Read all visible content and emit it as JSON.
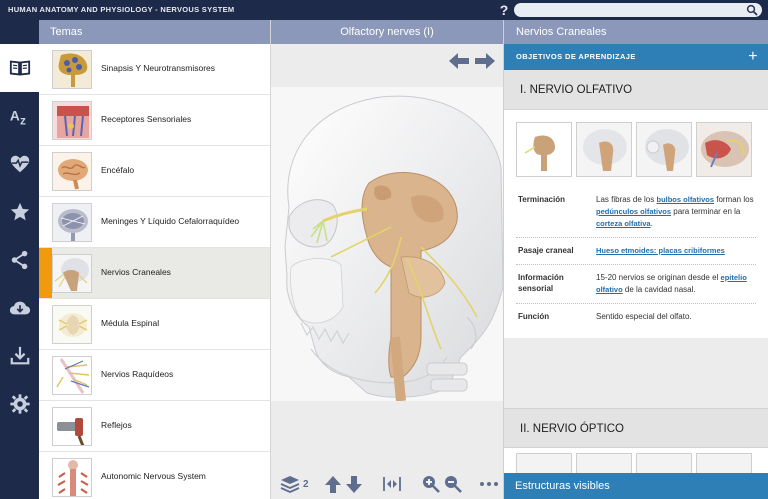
{
  "app": {
    "title": "HUMAN ANATOMY AND PHYSIOLOGY - NERVOUS SYSTEM",
    "help_icon": "help-icon",
    "search_placeholder": ""
  },
  "rail": {
    "items": [
      {
        "icon": "book-icon",
        "active": true
      },
      {
        "icon": "a-z-icon",
        "active": false
      },
      {
        "icon": "heartbeat-icon",
        "active": false
      },
      {
        "icon": "star-icon",
        "active": false
      },
      {
        "icon": "share-icon",
        "active": false
      },
      {
        "icon": "cloud-download-icon",
        "active": false
      },
      {
        "icon": "download-icon",
        "active": false
      },
      {
        "icon": "gear-icon",
        "active": false
      }
    ]
  },
  "topics": {
    "header": "Temas",
    "items": [
      {
        "label": "Sinapsis Y Neurotransmisores"
      },
      {
        "label": "Receptores Sensoriales"
      },
      {
        "label": "Encéfalo"
      },
      {
        "label": "Meninges Y Líquido Cefalorraquídeo"
      },
      {
        "label": "Nervios Craneales",
        "selected": true
      },
      {
        "label": "Médula Espinal"
      },
      {
        "label": "Nervios Raquídeos"
      },
      {
        "label": "Reflejos"
      },
      {
        "label": "Autonomic Nervous System"
      }
    ]
  },
  "viewer": {
    "header": "Olfactory nerves (I)",
    "layer_count": "2"
  },
  "info": {
    "header": "Nervios Craneales",
    "objectives": "OBJETIVOS DE APRENDIZAJE",
    "section1": {
      "title": "I. NERVIO OLFATIVO",
      "rows": [
        {
          "key": "Terminación",
          "parts": [
            {
              "t": "Las fibras de los "
            },
            {
              "t": "bulbos olfativos",
              "link": true
            },
            {
              "t": " forman los "
            },
            {
              "t": "pedúnculos olfativos",
              "link": true
            },
            {
              "t": " para terminar en la "
            },
            {
              "t": "corteza olfativa",
              "link": true
            },
            {
              "t": "."
            }
          ]
        },
        {
          "key": "Pasaje craneal",
          "parts": [
            {
              "t": "Hueso etmoides: placas cribiformes",
              "link": true
            }
          ]
        },
        {
          "key": "Información sensorial",
          "parts": [
            {
              "t": "15-20 nervios se originan desde el "
            },
            {
              "t": "epitelio olfativo",
              "link": true
            },
            {
              "t": " de la cavidad nasal."
            }
          ]
        },
        {
          "key": "Función",
          "parts": [
            {
              "t": "Sentido especial del olfato."
            }
          ]
        }
      ]
    },
    "section2": {
      "title": "II. NERVIO ÓPTICO"
    },
    "footer": "Estructuras visibles"
  },
  "colors": {
    "navy": "#1e2a4a",
    "header_blue_gray": "#8c98ba",
    "accent_blue": "#2e7fb5",
    "selection_orange": "#f19a0e"
  }
}
